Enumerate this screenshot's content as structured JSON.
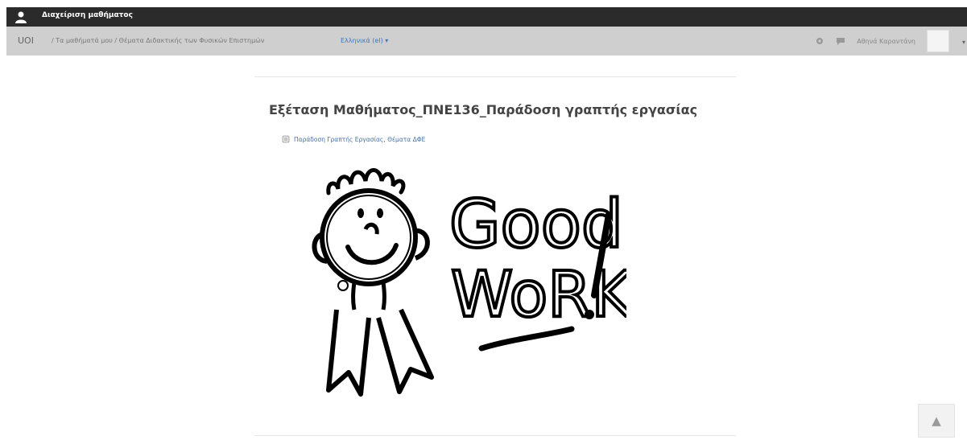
{
  "header": {
    "title": "Διαχείριση μαθήματος"
  },
  "nav": {
    "brand": "UOI",
    "breadcrumb": "/ Τα μαθήματά μου / Θέματα Διδακτικής των Φυσικών Επιστημών",
    "language": "Ελληνικά (el) ▾",
    "user_name": "Αθηνά Καραντάνη"
  },
  "main": {
    "heading": "Εξέταση Μαθήματος_ΠΝΕ136_Παράδοση γραπτής εργασίας",
    "file_link_label": "Παράδοση Γραπτής Εργασίας, Θέματα ΔΦΕ",
    "image_text": "Good Work!"
  },
  "icons": {
    "user": "user-icon",
    "settings": "gear-icon",
    "messages": "chat-icon",
    "avatar": "avatar",
    "scroll_top": "arrow-up-icon",
    "file": "file-icon"
  },
  "colors": {
    "topbar": "#2b2b2b",
    "navbar": "#cfcfcf",
    "link": "#3b76b8"
  }
}
